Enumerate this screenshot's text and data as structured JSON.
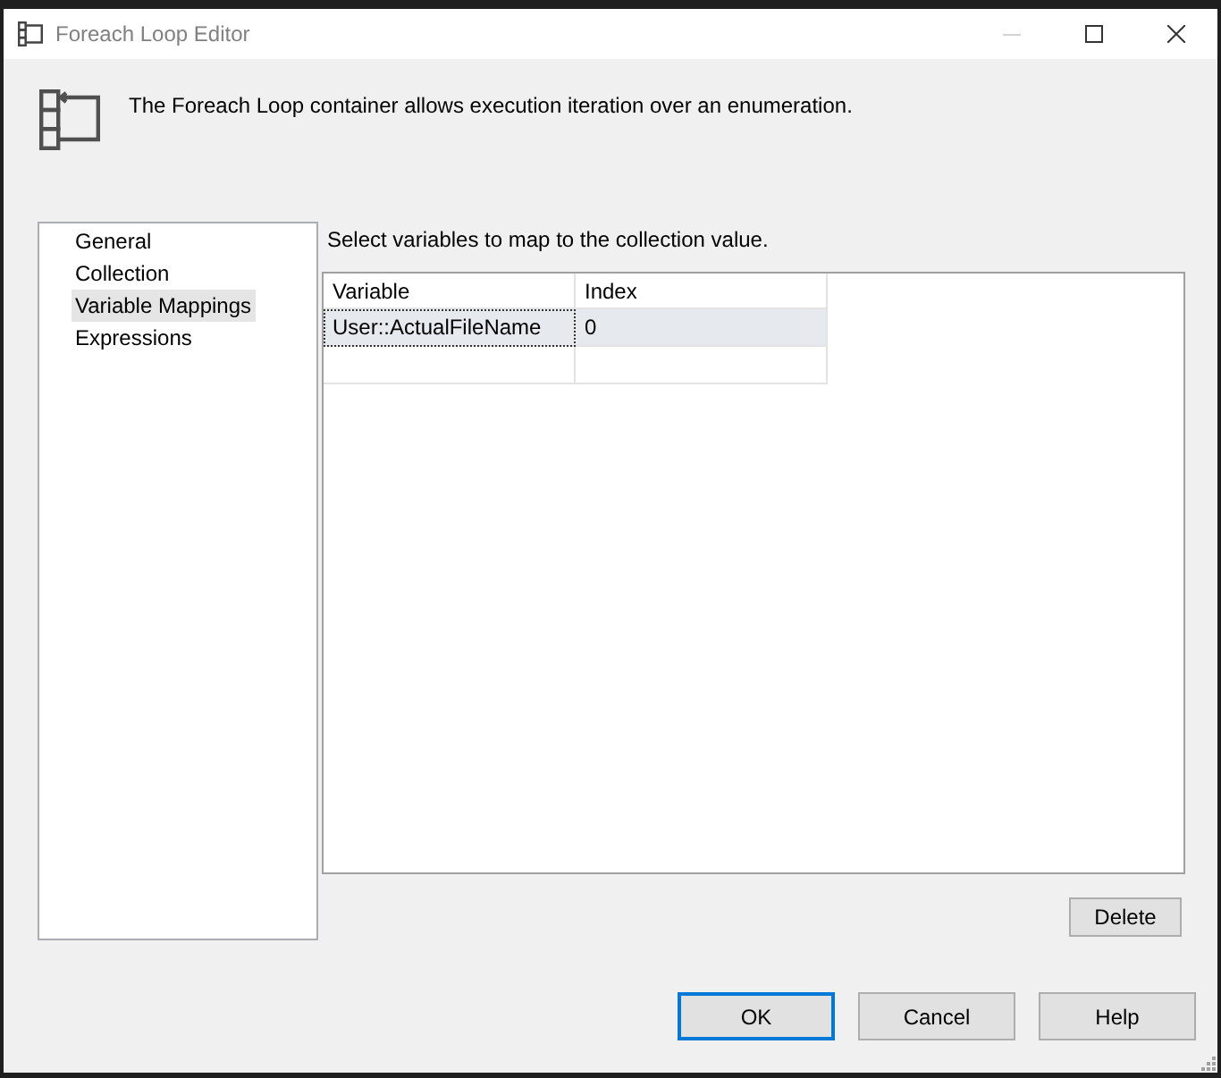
{
  "window": {
    "title": "Foreach Loop Editor",
    "controls": [
      {
        "kind": "minimize",
        "disabled": true
      },
      {
        "kind": "maximize",
        "disabled": false
      },
      {
        "kind": "close",
        "disabled": false
      }
    ]
  },
  "header": {
    "description": "The Foreach Loop container allows execution iteration over an enumeration."
  },
  "nav": {
    "items": [
      {
        "label": "General",
        "selected": false
      },
      {
        "label": "Collection",
        "selected": false
      },
      {
        "label": "Variable Mappings",
        "selected": true
      },
      {
        "label": "Expressions",
        "selected": false
      }
    ]
  },
  "mappings": {
    "instruction": "Select variables to map to the collection value.",
    "columns": [
      "Variable",
      "Index"
    ],
    "rows": [
      {
        "selected": true,
        "cells": [
          {
            "text": "User::ActualFileName",
            "focused": true
          },
          {
            "text": "0",
            "focused": false
          }
        ]
      }
    ],
    "delete_button": "Delete"
  },
  "buttons": [
    {
      "label": "OK",
      "default": true
    },
    {
      "label": "Cancel",
      "default": false
    },
    {
      "label": "Help",
      "default": false
    }
  ]
}
